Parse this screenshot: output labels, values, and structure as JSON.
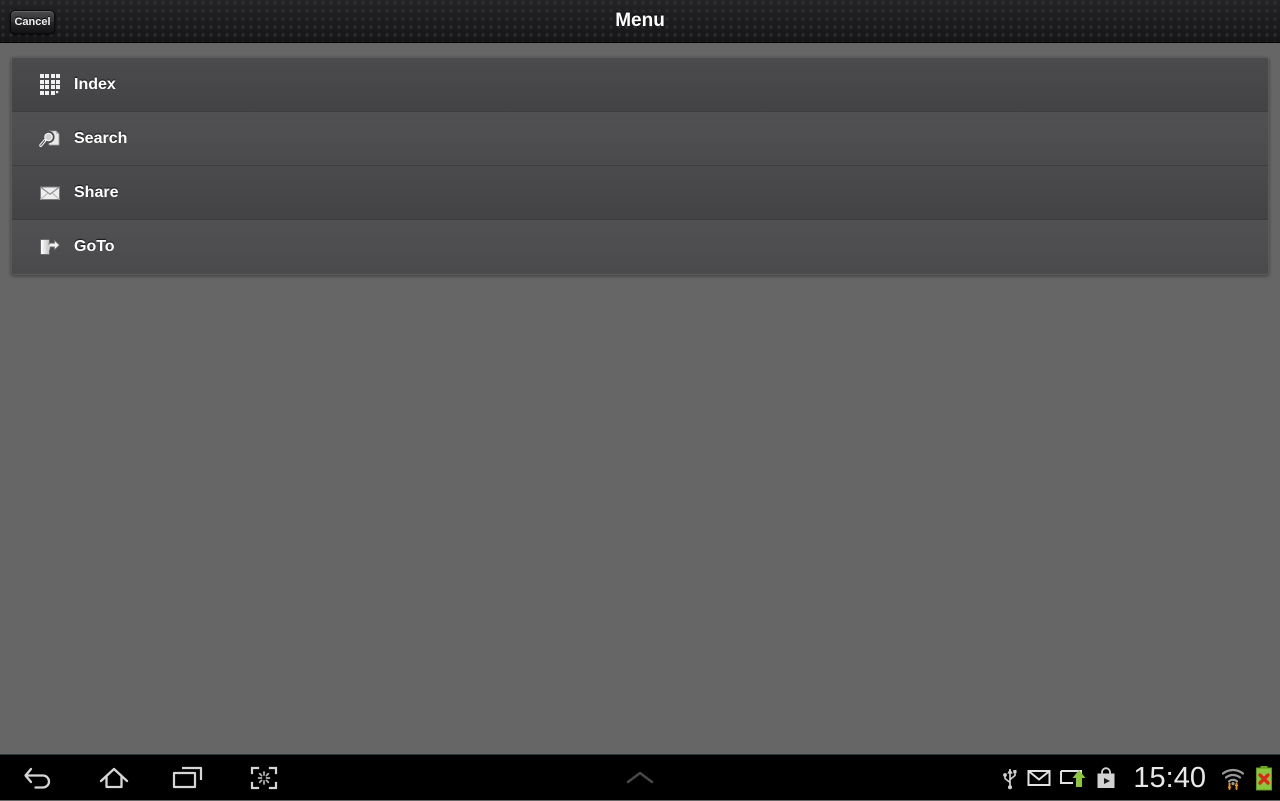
{
  "header": {
    "title": "Menu",
    "cancel_label": "Cancel"
  },
  "menu": {
    "items": [
      {
        "label": "Index",
        "icon": "grid-icon"
      },
      {
        "label": "Search",
        "icon": "magnifier-page-icon"
      },
      {
        "label": "Share",
        "icon": "envelope-icon"
      },
      {
        "label": "GoTo",
        "icon": "exit-arrow-icon"
      }
    ]
  },
  "navbar": {
    "back_label": "Back",
    "home_label": "Home",
    "recents_label": "Recents",
    "screenshot_label": "Screenshot",
    "handle_label": "Notifications",
    "clock": "15:40",
    "status_icons": [
      "usb-icon",
      "gmail-icon",
      "screen-cast-icon",
      "play-store-icon",
      "wifi-transfer-icon",
      "battery-error-icon"
    ]
  },
  "colors": {
    "page_background": "#666666",
    "panel_background": "#474749",
    "header_background": "#1b1b1d",
    "accent_green": "#8cc63f",
    "accent_orange": "#f2951b",
    "error_red": "#d92b1c",
    "text_primary": "#ffffff"
  }
}
